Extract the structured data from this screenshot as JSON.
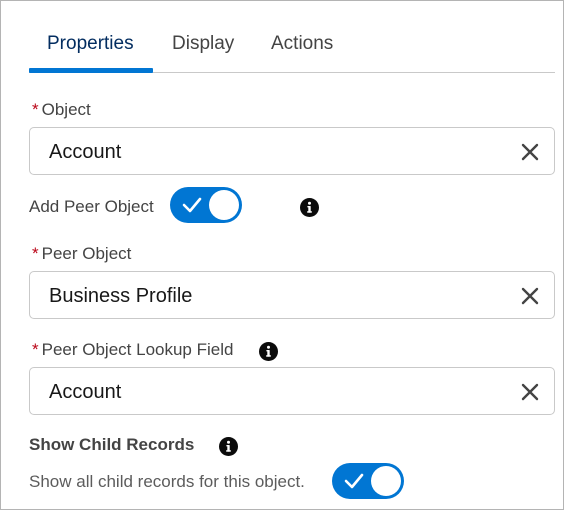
{
  "tabs": [
    {
      "label": "Properties",
      "active": true
    },
    {
      "label": "Display",
      "active": false
    },
    {
      "label": "Actions",
      "active": false
    }
  ],
  "object_field": {
    "required_mark": "*",
    "label": "Object",
    "value": "Account"
  },
  "add_peer_object": {
    "label": "Add Peer Object",
    "enabled": true
  },
  "peer_object_field": {
    "required_mark": "*",
    "label": "Peer Object",
    "value": "Business Profile"
  },
  "peer_lookup_field": {
    "required_mark": "*",
    "label": "Peer Object Lookup Field",
    "value": "Account"
  },
  "show_child_records": {
    "title": "Show Child Records",
    "help": "Show all child records for this object.",
    "enabled": true
  },
  "icons": {
    "clear": "close-icon",
    "info": "info-icon",
    "check": "check-icon"
  },
  "colors": {
    "accent": "#0176d3",
    "required": "#ba0517",
    "border": "#c9c9c9"
  }
}
